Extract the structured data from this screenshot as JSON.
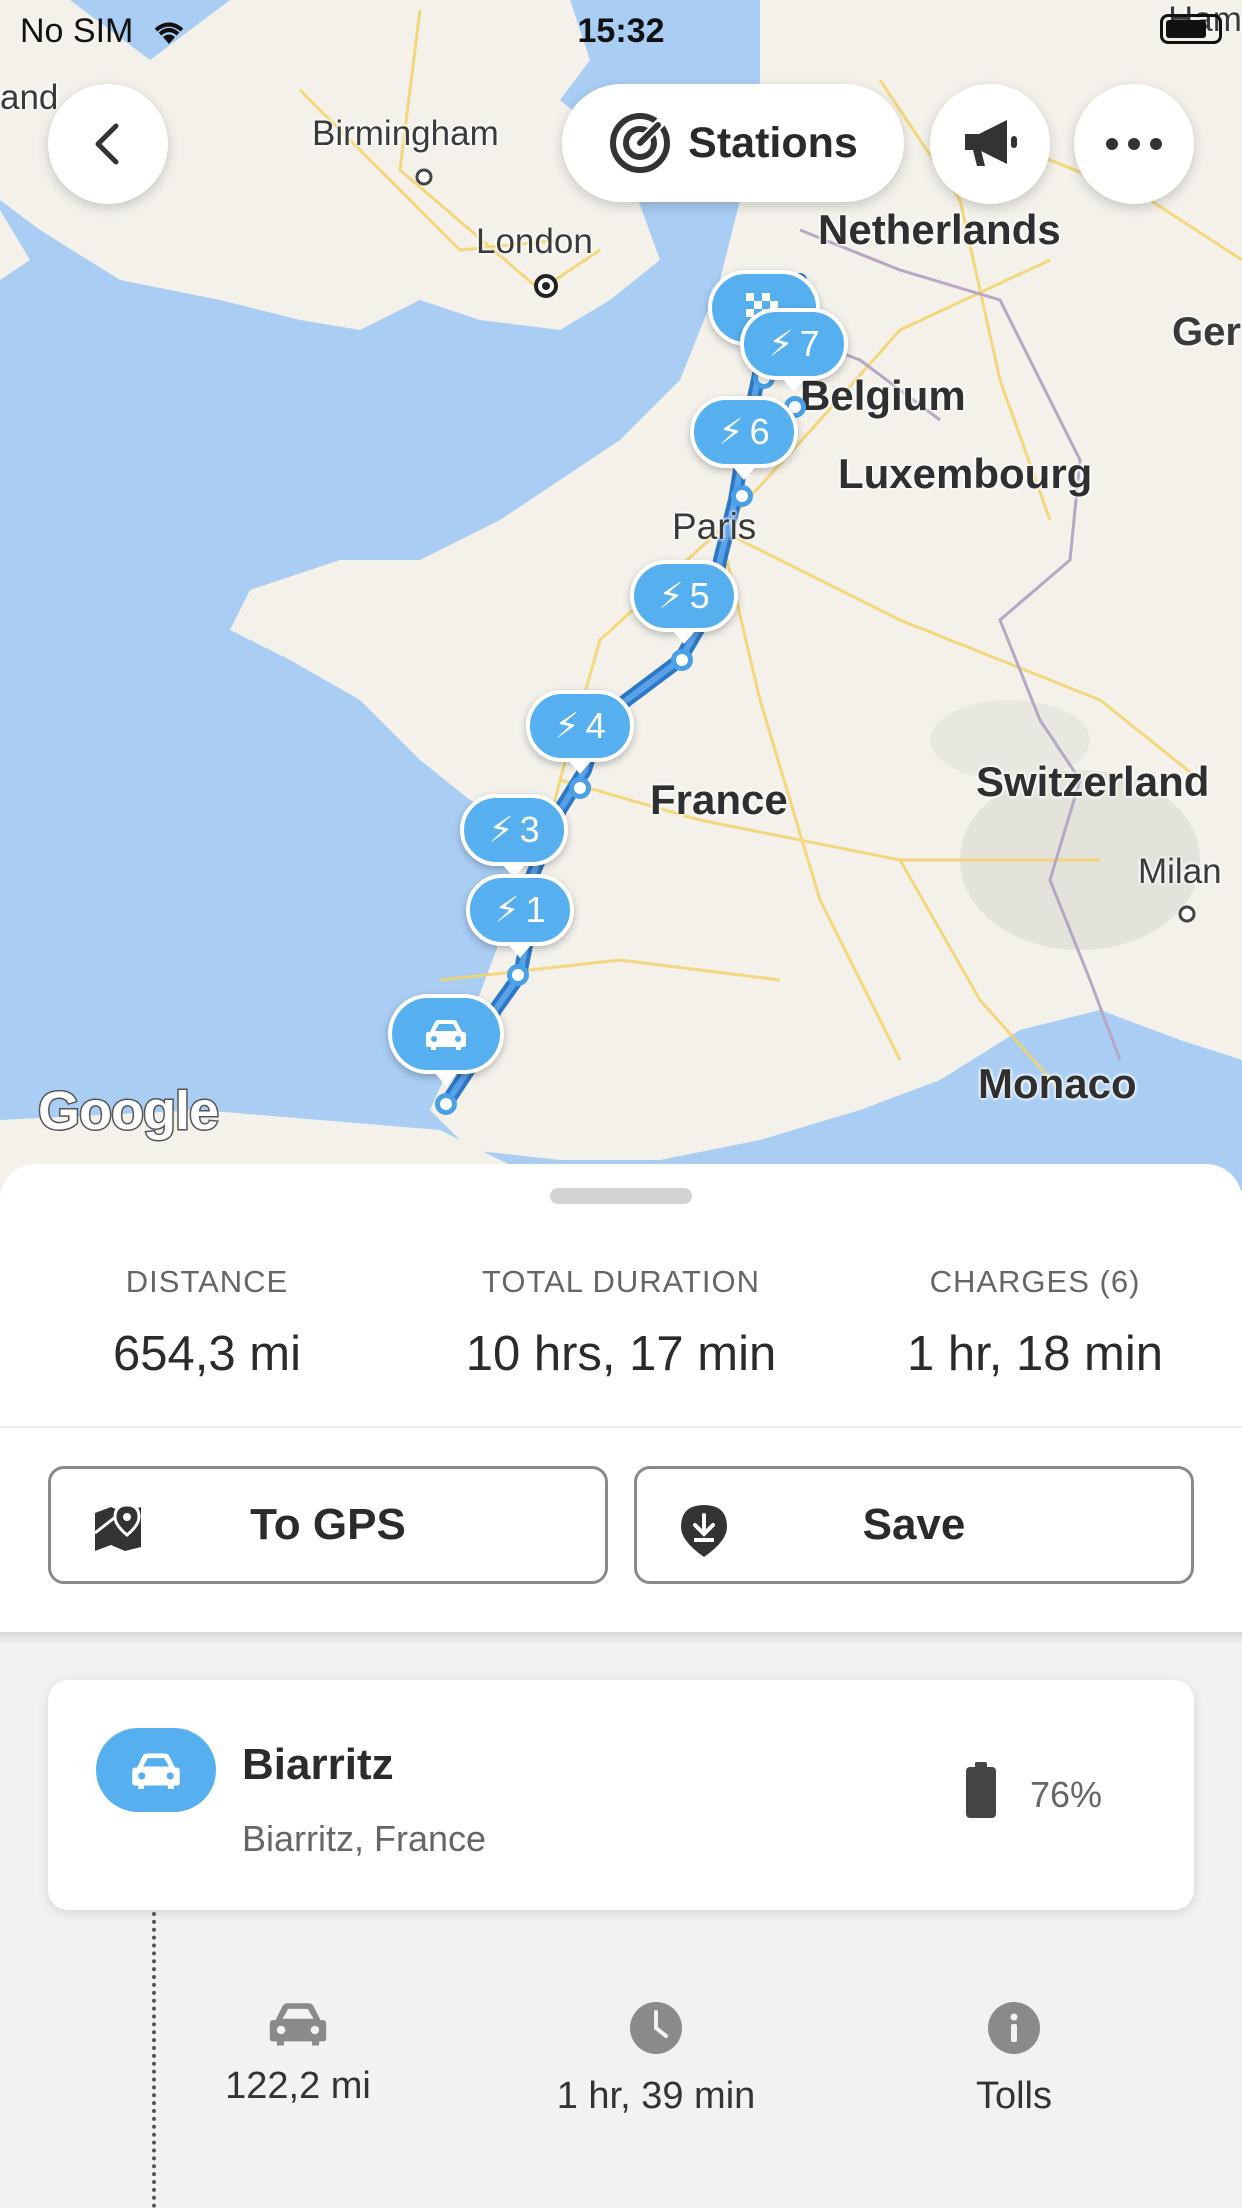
{
  "status_bar": {
    "carrier": "No SIM",
    "time": "15:32"
  },
  "map": {
    "stations_label": "Stations",
    "cities": {
      "birmingham": "Birmingham",
      "london": "London",
      "paris": "Paris",
      "milan": "Milan",
      "monaco": "Monaco",
      "ireland_partial": "and",
      "germany_partial": "Ger",
      "hamburg_partial": "Ham"
    },
    "countries": {
      "netherlands": "Netherlands",
      "belgium": "Belgium",
      "luxembourg": "Luxembourg",
      "france": "France",
      "switzerland": "Switzerland"
    },
    "stops": [
      "7",
      "6",
      "5",
      "4",
      "3",
      "1"
    ],
    "attribution": "Google",
    "colors": {
      "water": "#a9cdf3",
      "land": "#f3f1ea",
      "route": "#3a86d4",
      "pin": "#56b0ef"
    }
  },
  "summary": {
    "distance_label": "DISTANCE",
    "distance_value": "654,3 mi",
    "duration_label": "TOTAL DURATION",
    "duration_value": "10 hrs, 17 min",
    "charges_label": "CHARGES (6)",
    "charges_value": "1 hr, 18 min"
  },
  "actions": {
    "gps_label": "To GPS",
    "save_label": "Save"
  },
  "origin": {
    "title": "Biarritz",
    "subtitle": "Biarritz, France",
    "battery": "76%"
  },
  "leg": {
    "distance": "122,2 mi",
    "duration": "1 hr, 39 min",
    "tolls": "Tolls"
  }
}
